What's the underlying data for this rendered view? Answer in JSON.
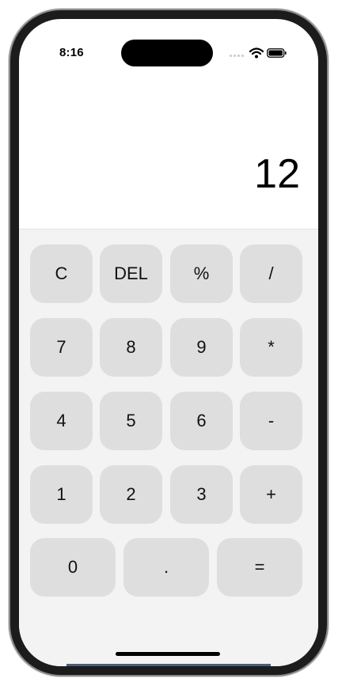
{
  "status_bar": {
    "time": "8:16",
    "icons": [
      "cellular-signal-icon",
      "wifi-icon",
      "battery-icon"
    ]
  },
  "display": {
    "value": "12"
  },
  "keypad": {
    "rows": [
      [
        "C",
        "DEL",
        "%",
        "/"
      ],
      [
        "7",
        "8",
        "9",
        "*"
      ],
      [
        "4",
        "5",
        "6",
        "-"
      ],
      [
        "1",
        "2",
        "3",
        "+"
      ],
      [
        "0",
        ".",
        "="
      ]
    ]
  },
  "colors": {
    "key_background": "#dedede",
    "keypad_background": "#f3f3f3",
    "display_background": "#ffffff",
    "text": "#000000"
  }
}
